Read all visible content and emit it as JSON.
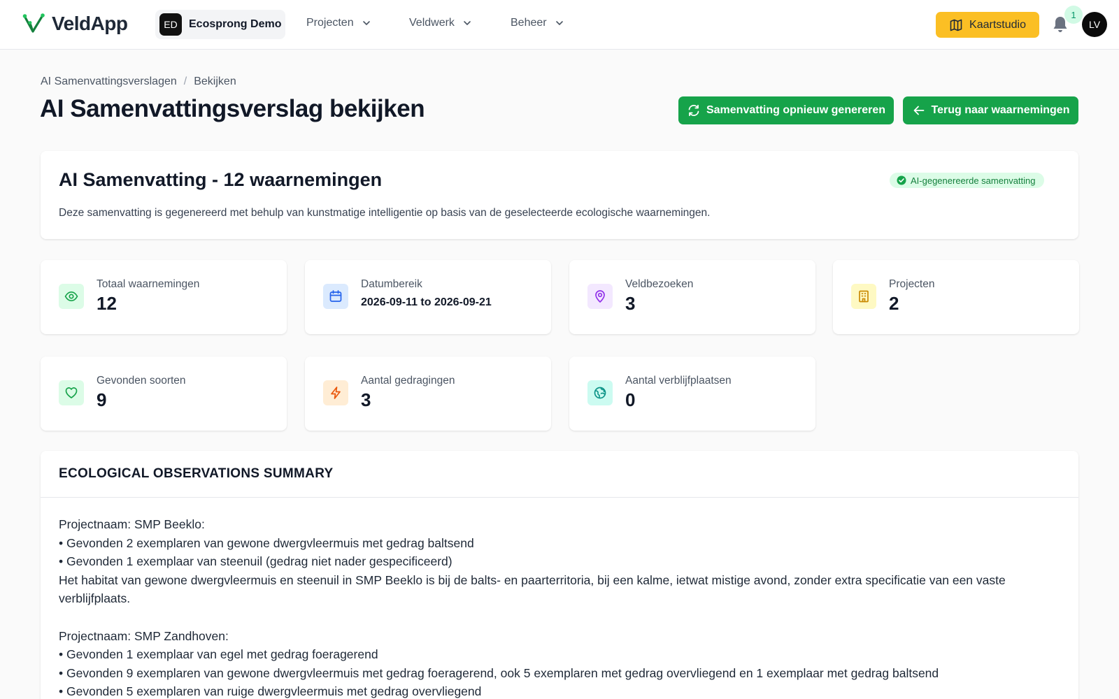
{
  "nav": {
    "app_name": "VeldApp",
    "org_initials": "ED",
    "org_name": "Ecosprong Demo",
    "menu": [
      {
        "label": "Projecten"
      },
      {
        "label": "Veldwerk"
      },
      {
        "label": "Beheer"
      }
    ],
    "map_studio_label": "Kaartstudio",
    "notification_count": "1",
    "user_initials": "LV"
  },
  "breadcrumb": {
    "parent": "AI Samenvattingsverslagen",
    "separator": "/",
    "current": "Bekijken"
  },
  "page": {
    "title": "AI Samenvattingsverslag bekijken",
    "regenerate_label": "Samenvatting opnieuw genereren",
    "back_label": "Terug naar waarnemingen"
  },
  "summary": {
    "title": "AI Samenvatting - 12 waarnemingen",
    "badge": "AI-gegenereerde samenvatting",
    "description": "Deze samenvatting is gegenereerd met behulp van kunstmatige intelligentie op basis van de geselecteerde ecologische waarnemingen."
  },
  "stats": {
    "total": {
      "label": "Totaal waarnemingen",
      "value": "12",
      "icon": "eye-icon"
    },
    "date_range": {
      "label": "Datumbereik",
      "value": "2026-09-11 to 2026-09-21",
      "icon": "calendar-icon"
    },
    "visits": {
      "label": "Veldbezoeken",
      "value": "3",
      "icon": "map-pin-icon"
    },
    "projects": {
      "label": "Projecten",
      "value": "2",
      "icon": "building-icon"
    },
    "species": {
      "label": "Gevonden soorten",
      "value": "9",
      "icon": "heart-icon"
    },
    "behaviours": {
      "label": "Aantal gedragingen",
      "value": "3",
      "icon": "lightning-icon"
    },
    "roosts": {
      "label": "Aantal verblijfplaatsen",
      "value": "0",
      "icon": "globe-icon"
    }
  },
  "colors": {
    "primary_green": "#16a34a",
    "map_studio_yellow": "#fbbf24"
  },
  "report": {
    "title": "ECOLOGICAL OBSERVATIONS SUMMARY",
    "lines": [
      "Projectnaam: SMP Beeklo:",
      "• Gevonden 2 exemplaren van gewone dwergvleermuis met gedrag baltsend",
      "• Gevonden 1 exemplaar van steenuil (gedrag niet nader gespecificeerd)",
      "Het habitat van gewone dwergvleermuis en steenuil in SMP Beeklo is bij de balts- en paarterritoria, bij een kalme, ietwat mistige avond, zonder extra specificatie van een vaste verblijfplaats.",
      "Projectnaam: SMP Zandhoven:",
      "• Gevonden 1 exemplaar van egel met gedrag foeragerend",
      "• Gevonden 9 exemplaren van gewone dwergvleermuis met gedrag foeragerend, ook 5 exemplaren met gedrag overvliegend en 1 exemplaar met gedrag baltsend",
      "• Gevonden 5 exemplaren van ruige dwergvleermuis met gedrag overvliegend"
    ]
  }
}
